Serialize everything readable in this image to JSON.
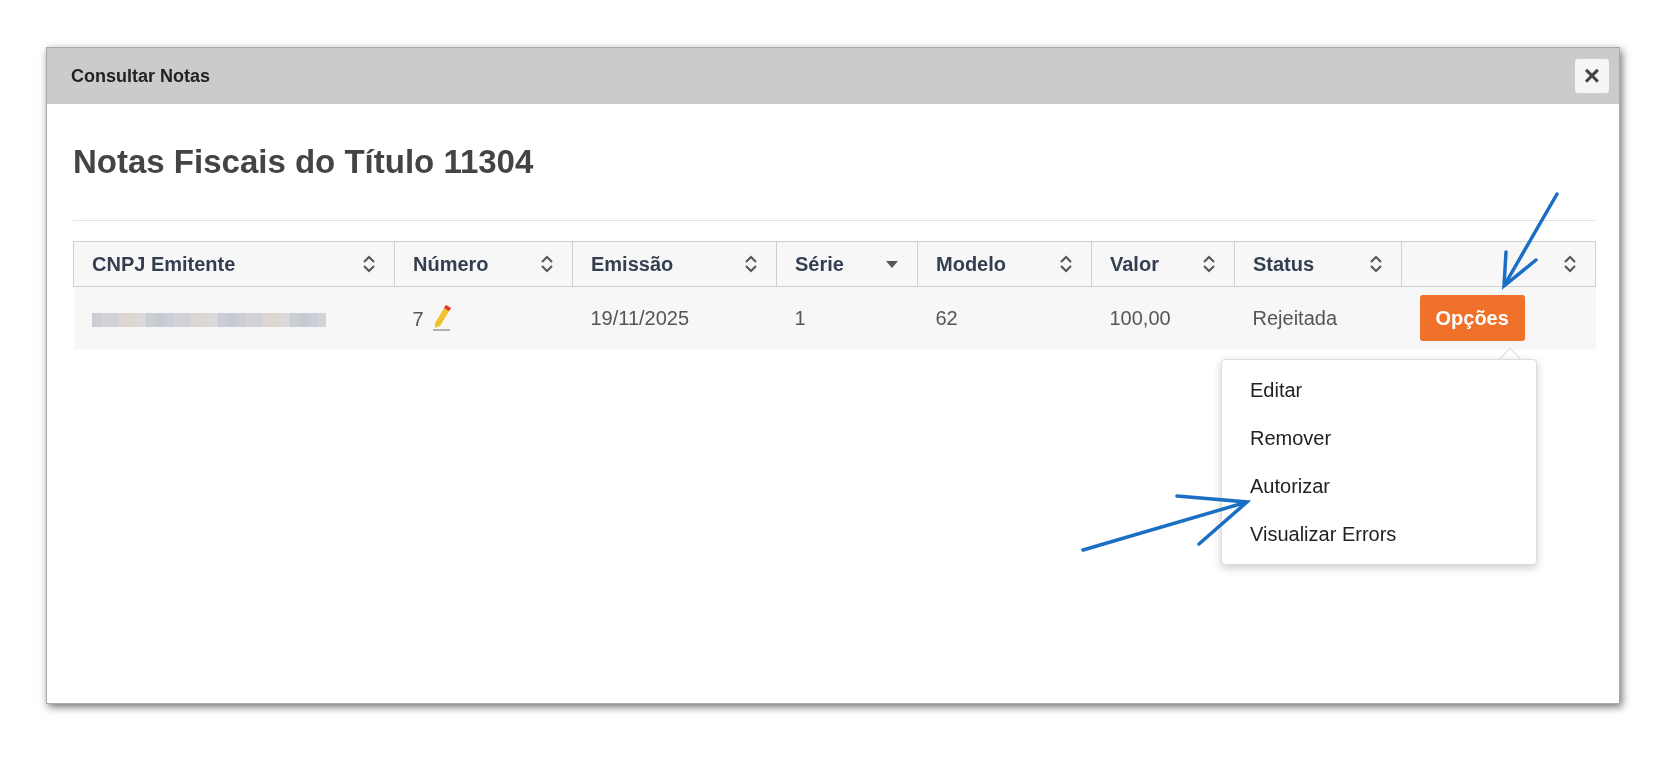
{
  "dialog": {
    "title": "Consultar Notas",
    "close_label": "×"
  },
  "heading": "Notas Fiscais do Título 11304",
  "table": {
    "columns": [
      {
        "label": "CNPJ Emitente",
        "sorted_desc": false
      },
      {
        "label": "Número",
        "sorted_desc": false
      },
      {
        "label": "Emissão",
        "sorted_desc": false
      },
      {
        "label": "Série",
        "sorted_desc": true
      },
      {
        "label": "Modelo",
        "sorted_desc": false
      },
      {
        "label": "Valor",
        "sorted_desc": false
      },
      {
        "label": "Status",
        "sorted_desc": false
      },
      {
        "sorted_desc": false
      }
    ],
    "rows": [
      {
        "cnpj_redacted": true,
        "numero": "7",
        "emissao": "19/11/2025",
        "serie": "1",
        "modelo": "62",
        "valor": "100,00",
        "status": "Rejeitada",
        "button": "Opções"
      }
    ]
  },
  "options_menu": {
    "open": true,
    "items": [
      "Editar",
      "Remover",
      "Autorizar",
      "Visualizar Errors"
    ]
  }
}
